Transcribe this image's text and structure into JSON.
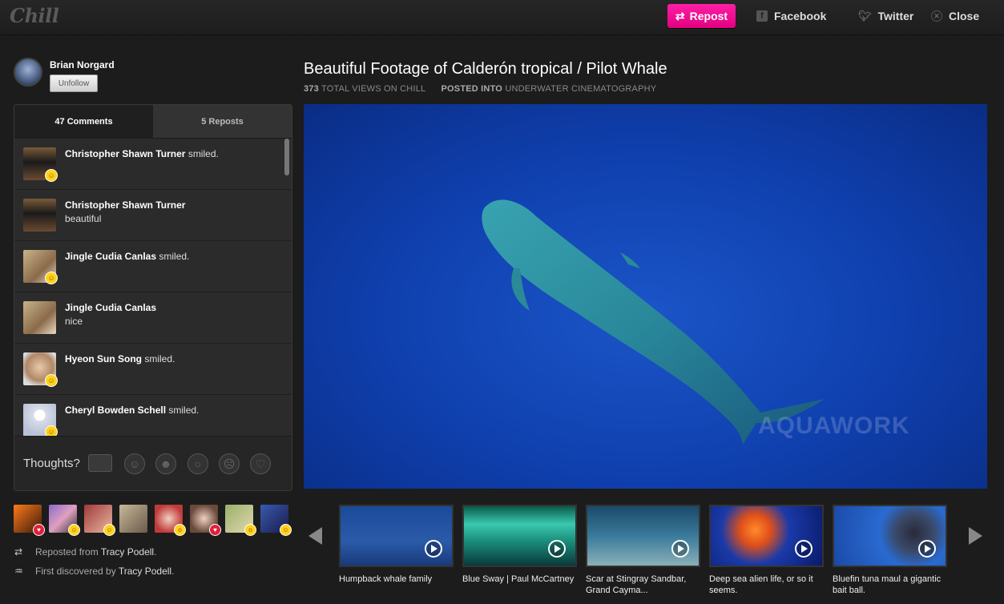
{
  "app": {
    "logo": "Chill"
  },
  "topbar": {
    "repost_label": "Repost",
    "facebook_label": "Facebook",
    "twitter_label": "Twitter",
    "close_label": "Close"
  },
  "profile": {
    "name": "Brian Norgard",
    "unfollow_label": "Unfollow"
  },
  "tabs": {
    "comments": "47 Comments",
    "reposts": "5 Reposts"
  },
  "comments": [
    {
      "author": "Christopher Shawn Turner",
      "text": "smiled.",
      "inline": true,
      "emoji": true
    },
    {
      "author": "Christopher Shawn Turner",
      "text": "beautiful",
      "inline": false,
      "emoji": false
    },
    {
      "author": "Jingle Cudia Canlas",
      "text": "smiled.",
      "inline": true,
      "emoji": true
    },
    {
      "author": "Jingle Cudia Canlas",
      "text": "nice",
      "inline": false,
      "emoji": false
    },
    {
      "author": "Hyeon Sun Song",
      "text": "smiled.",
      "inline": true,
      "emoji": true
    },
    {
      "author": "Cheryl Bowden Schell",
      "text": "smiled.",
      "inline": true,
      "emoji": true
    }
  ],
  "thoughts": {
    "label": "Thoughts?"
  },
  "activity": {
    "reposted_prefix": "Reposted from",
    "reposted_user": "Tracy Podell",
    "discovered_prefix": "First discovered by",
    "discovered_user": "Tracy Podell"
  },
  "video": {
    "title": "Beautiful Footage of Calderón tropical / Pilot Whale",
    "views_count": "373",
    "views_label": "TOTAL VIEWS ON CHILL",
    "posted_label": "POSTED INTO",
    "posted_category": "UNDERWATER CINEMATOGRAPHY",
    "watermark": "AQUAWORK"
  },
  "related": [
    {
      "caption": "Humpback whale family"
    },
    {
      "caption": "Blue Sway | Paul McCartney"
    },
    {
      "caption": "Scar at Stingray Sandbar, Grand Cayma..."
    },
    {
      "caption": "Deep sea alien life, or so it seems."
    },
    {
      "caption": "Bluefin tuna maul a gigantic bait ball."
    }
  ],
  "colors": {
    "accent": "#e6007f",
    "background": "#1c1c1c",
    "video_blue": "#0f3fad"
  }
}
